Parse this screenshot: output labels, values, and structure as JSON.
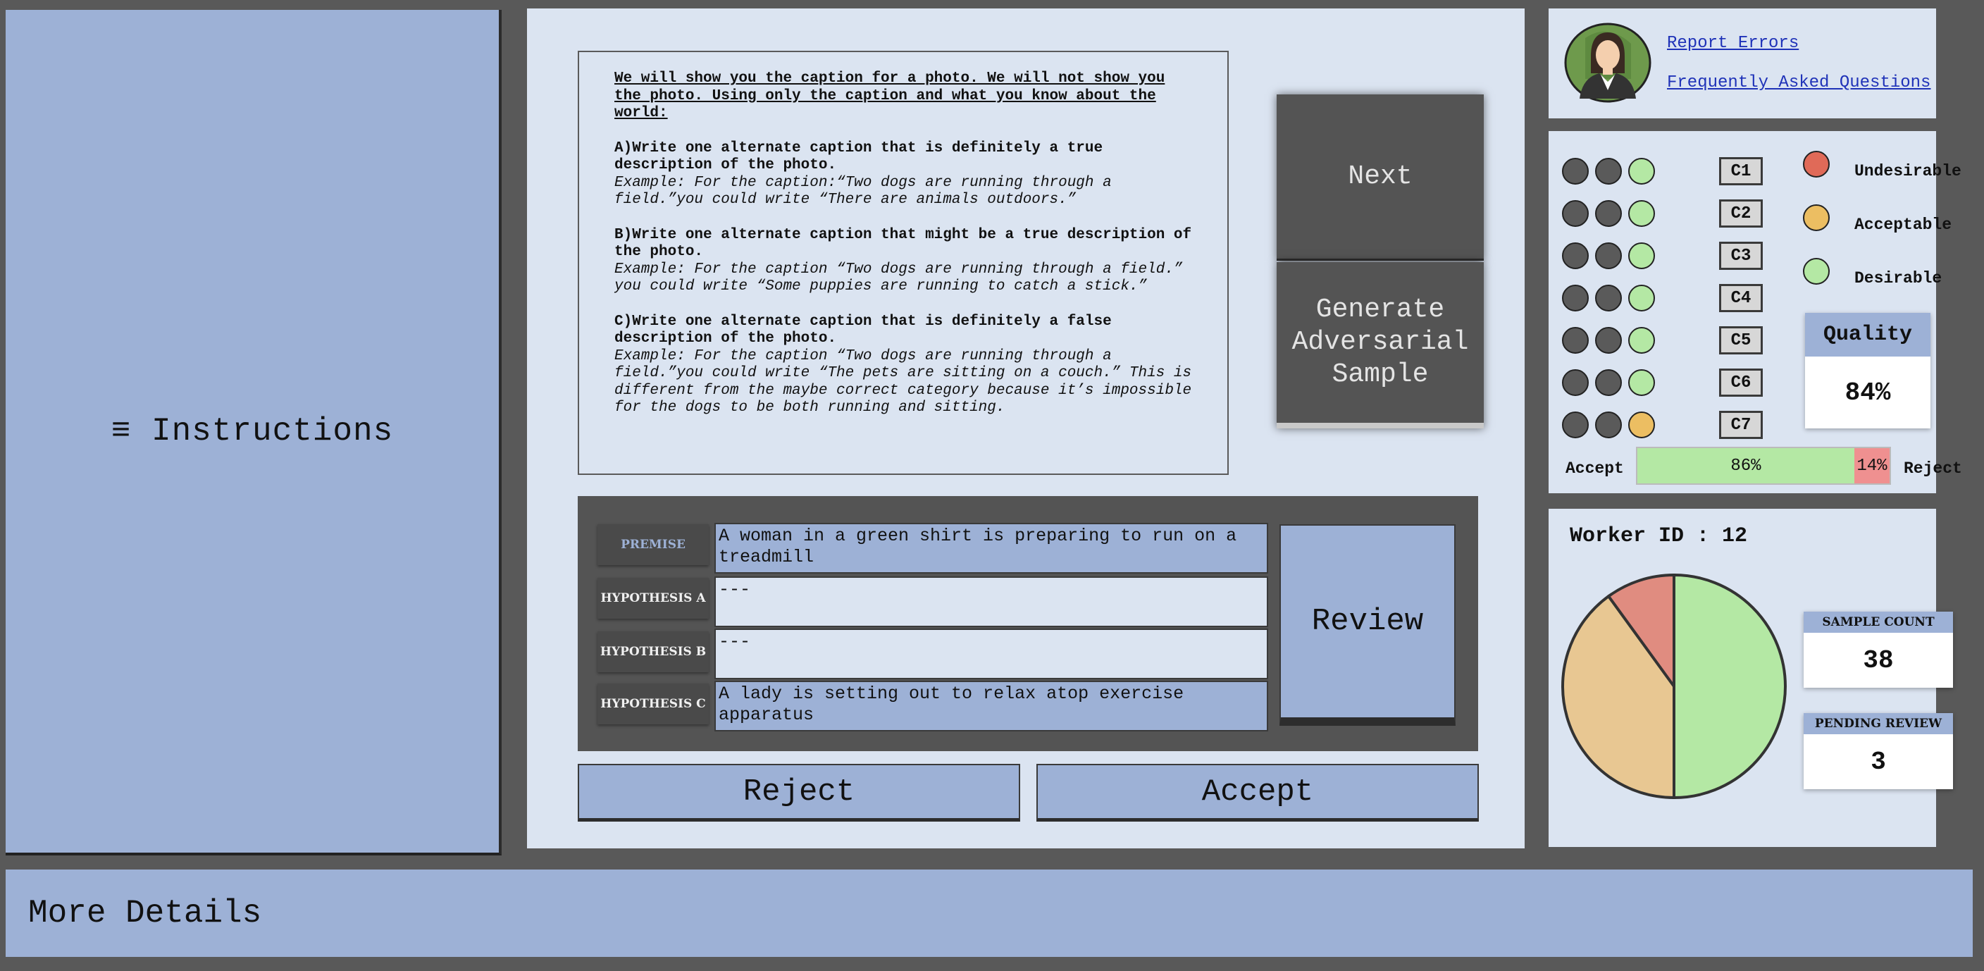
{
  "instructions_panel": {
    "label": "≡ Instructions"
  },
  "instructions": {
    "intro": "We will show you the caption for a photo. We will not show you the photo. Using only the caption and what you know about the world:",
    "a_head": "A)Write one alternate caption that is definitely a true description of the photo.",
    "a_example": "Example: For the caption:“Two dogs are running through a field.”you could write “There are animals outdoors.”",
    "b_head": "B)Write one alternate caption that might be a true description of the photo.",
    "b_example": "Example: For the caption “Two dogs are running through a field.” you could write “Some puppies are running to catch a stick.”",
    "c_head": "C)Write one alternate caption that is definitely a false description of the photo.",
    "c_example": "Example: For the caption “Two dogs are running through a field.”you could write “The pets are sitting on a couch.” This is different from the maybe correct category because it’s impossible for the dogs to be both running and sitting."
  },
  "buttons": {
    "next": "Next",
    "generate": "Generate Adversarial Sample",
    "review": "Review",
    "reject": "Reject",
    "accept": "Accept"
  },
  "hypotheses": {
    "premise_label": "PREMISE",
    "premise_value": "A woman in a green shirt is preparing to run on a treadmill",
    "a_label": "HYPOTHESIS A",
    "a_value": "---",
    "b_label": "HYPOTHESIS B",
    "b_value": "---",
    "c_label": "HYPOTHESIS C",
    "c_value": "A lady is setting out to relax atop exercise apparatus"
  },
  "links": {
    "report": "Report Errors",
    "faq": "Frequently Asked Questions"
  },
  "criteria": {
    "labels": [
      "C1",
      "C2",
      "C3",
      "C4",
      "C5",
      "C6",
      "C7"
    ],
    "status": [
      "desirable",
      "desirable",
      "desirable",
      "desirable",
      "desirable",
      "desirable",
      "acceptable"
    ]
  },
  "legend": {
    "undesirable": "Undesirable",
    "acceptable": "Acceptable",
    "desirable": "Desirable"
  },
  "colors": {
    "desirable": "#b4e8a4",
    "acceptable": "#ecbe62",
    "undesirable": "#e06a58",
    "pie_accept": "#b4e8a4",
    "pie_mid": "#e8c792",
    "pie_reject": "#e08c80"
  },
  "quality": {
    "label": "Quality",
    "value": "84%"
  },
  "accept_reject": {
    "accept_label": "Accept",
    "reject_label": "Reject",
    "accept_pct": 86,
    "reject_pct": 14,
    "accept_text": "86%",
    "reject_text": "14%"
  },
  "worker": {
    "id_text": "Worker ID : 12"
  },
  "worker_pie": {
    "fractions": [
      0.5,
      0.4,
      0.1
    ]
  },
  "stats": {
    "sample_label": "SAMPLE COUNT",
    "sample_value": "38",
    "pending_label": "PENDING REVIEW",
    "pending_value": "3"
  },
  "details": {
    "label": "More Details"
  }
}
